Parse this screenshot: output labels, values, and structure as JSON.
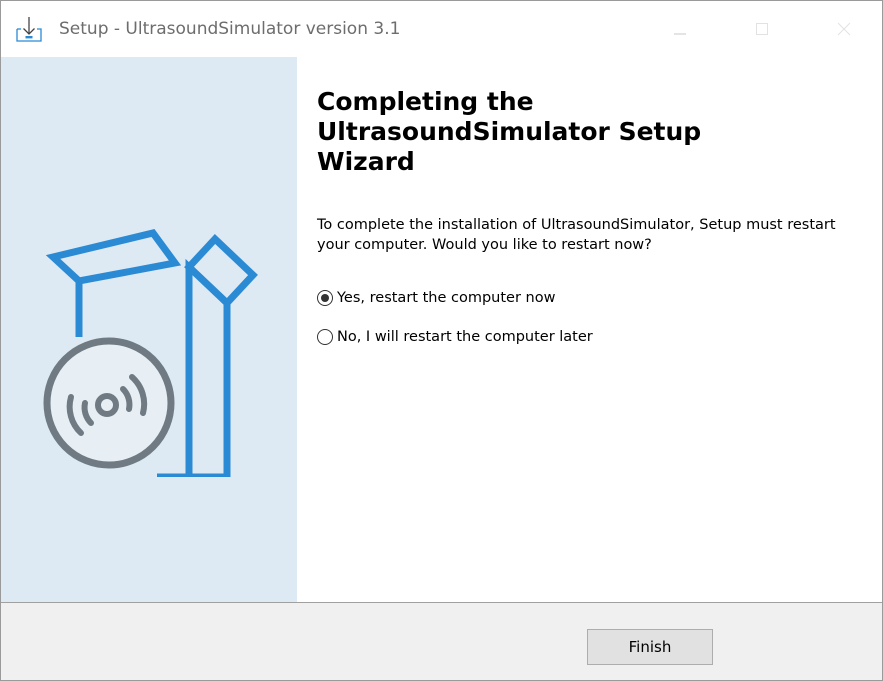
{
  "window": {
    "title": "Setup - UltrasoundSimulator version 3.1",
    "icon": "setup-download-icon",
    "controls": [
      "minimize-icon",
      "maximize-icon",
      "close-icon"
    ]
  },
  "sidebar": {
    "illustration": "software-box-with-disc-icon",
    "background_color": "#dde9f3",
    "accent_color": "#2a8ad4"
  },
  "main": {
    "heading": "Completing the UltrasoundSimulator Setup Wizard",
    "description": "To complete the installation of UltrasoundSimulator, Setup must restart your computer. Would you like to restart now?",
    "options": [
      {
        "label": "Yes, restart the computer now",
        "selected": true
      },
      {
        "label": "No, I will restart the computer later",
        "selected": false
      }
    ]
  },
  "footer": {
    "finish_label": "Finish"
  }
}
